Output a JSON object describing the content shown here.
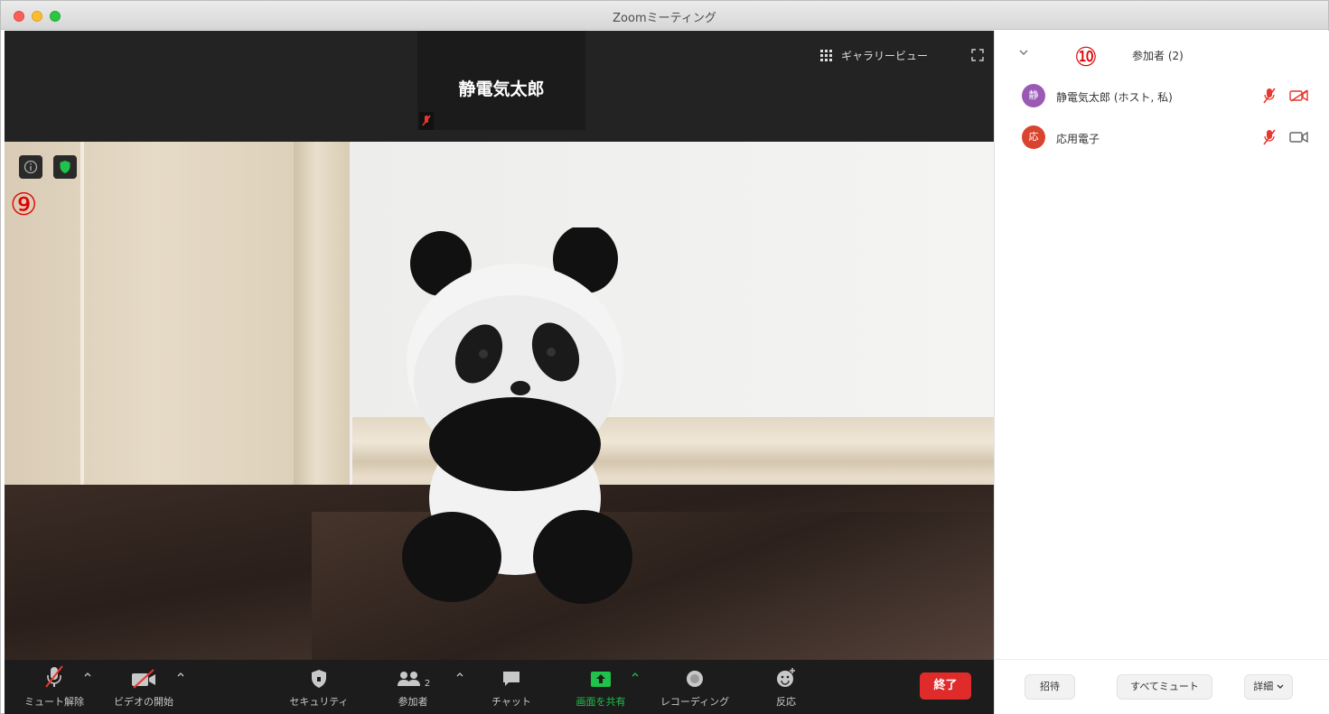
{
  "window": {
    "title": "Zoomミーティング"
  },
  "header": {
    "thumbnail_name": "静電気太郎",
    "gallery_view_label": "ギャラリービュー"
  },
  "annotations": {
    "nine": "⑨",
    "ten": "⑩"
  },
  "toolbar": {
    "unmute_label": "ミュート解除",
    "start_video_label": "ビデオの開始",
    "security_label": "セキュリティ",
    "participants_label": "参加者",
    "participants_count": "2",
    "chat_label": "チャット",
    "share_screen_label": "画面を共有",
    "recording_label": "レコーディング",
    "reactions_label": "反応",
    "end_label": "終了"
  },
  "panel": {
    "title": "参加者 (2)",
    "participants": [
      {
        "initial": "静",
        "name": "静電気太郎 (ホスト, 私)",
        "avatar_color": "#9b59b6"
      },
      {
        "initial": "応",
        "name": "応用電子",
        "avatar_color": "#d9442e"
      }
    ],
    "invite_label": "招待",
    "mute_all_label": "すべてミュート",
    "more_label": "詳細"
  },
  "colors": {
    "end_button": "#e02b2b",
    "share_green": "#1fc24a",
    "muted_red": "#e8372f",
    "annotation_red": "#e00000",
    "toolbar_bg": "#1c1c1c"
  }
}
